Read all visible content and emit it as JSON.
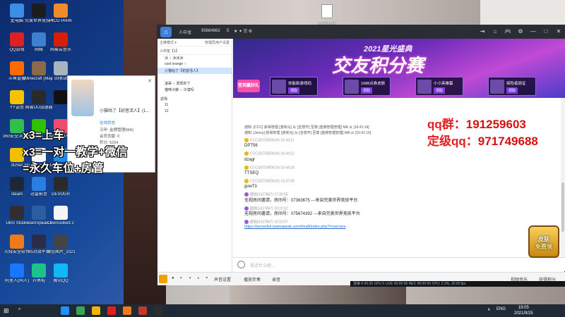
{
  "desktop_icons": [
    {
      "label": "此电脑",
      "color": "#3a8ee6"
    },
    {
      "label": "完美世界竞技平台",
      "color": "#1c1c1c"
    },
    {
      "label": "PICO PARK",
      "color": "#f08a2a"
    },
    {
      "label": "QQ游戏",
      "color": "#e02020"
    },
    {
      "label": "网络",
      "color": "#3f7fd0"
    },
    {
      "label": "网易云音乐",
      "color": "#d81e06"
    },
    {
      "label": "斗鱼直播",
      "color": "#ff6a00"
    },
    {
      "label": "Minecraft (Majiang...",
      "color": "#8a6a4a"
    },
    {
      "label": "回收站",
      "color": "#aab4bf"
    },
    {
      "label": "YY语音",
      "color": "#f7c300"
    },
    {
      "label": "网易UU加速器",
      "color": "#2a2a2a"
    },
    {
      "label": "",
      "color": "#111"
    },
    {
      "label": "360安全浏览器",
      "color": "#2fbf4a"
    },
    {
      "label": "微信",
      "color": "#2dc100"
    },
    {
      "label": "Pummel Party",
      "color": "#ef4d6d"
    },
    {
      "label": "3DSer",
      "color": "#f3c000"
    },
    {
      "label": "Human Fall Flat",
      "color": "#f5f5f5"
    },
    {
      "label": "Guest",
      "color": "#1e88e5"
    },
    {
      "label": "steam",
      "color": "#1b2838"
    },
    {
      "label": "迅雷影音",
      "color": "#2a7de1"
    },
    {
      "label": "DEVOUR",
      "color": "#2a2a2a"
    },
    {
      "label": "OBS Studio",
      "color": "#302e31"
    },
    {
      "label": "TeamSpeak 3",
      "color": "#2d5da1"
    },
    {
      "label": "Overcooked 2",
      "color": "#f5f5f5"
    },
    {
      "label": "火绒安全软件",
      "color": "#f07a1a"
    },
    {
      "label": "B5对战平台",
      "color": "#2b2b4a"
    },
    {
      "label": "微信图片_2021091...",
      "color": "#444"
    },
    {
      "label": "阿里人(同人)",
      "color": "#1677ff"
    },
    {
      "label": "开黑啦",
      "color": "#1ec28b"
    },
    {
      "label": "腾讯QQ",
      "color": "#12b7f5"
    }
  ],
  "file_icon": {
    "label": "config.cfg"
  },
  "profile_card": {
    "name": "小猫咕了【初音活人】(1...",
    "status": "在线状态",
    "rows": [
      {
        "k": "马甲:",
        "v": "金牌管理(MA)"
      },
      {
        "k": "会员贡献:",
        "v": "0"
      },
      {
        "k": "积分:",
        "v": "5234"
      }
    ],
    "close": "✕"
  },
  "overlay": {
    "line1": "x3=上车",
    "line2": "x3=一对一教学+微信",
    "line3": "=永久车位+房管"
  },
  "qq_info": {
    "label1": "qq群：",
    "num1": "191259603",
    "label2": "定级qq：",
    "num2": "971749688"
  },
  "titlebar": {
    "room_label": "人中龙",
    "room_id": "95684862",
    "user_count": "5",
    "buttons": [
      "⇥",
      "⌂",
      "🎮",
      "⚙",
      "—",
      "□",
      "✕"
    ]
  },
  "left_panel": {
    "tools_label": "主席模式 ▾",
    "tools_right": "管理员用户设置",
    "channel_header": "人中龙【1】",
    "items": [
      "冰 ♀ 冰冰冰",
      "cool orange ♀",
      "小猫咕了【初音活人】",
      "",
      "凌昊 ♀ 发现你了",
      "猫咪冷傲 ♀ 冷漠吗"
    ],
    "sub_header": "返场",
    "sub_items": [
      "11",
      "12"
    ]
  },
  "banner": {
    "year_label": "2021星光盛典",
    "title": "交友积分赛",
    "signin_label": "签到赢好礼",
    "cards": [
      {
        "tag": "小组主力",
        "title": "技能新游戏码",
        "btn": "领取"
      },
      {
        "tag": "上线奖励",
        "title": "1688点券皮肤",
        "btn": "领取"
      },
      {
        "tag": "日常活跃",
        "title": "小小英雄蛋",
        "btn": "领取"
      },
      {
        "tag": "DNF",
        "title": "探险者勋证",
        "btn": "领取"
      }
    ]
  },
  "chat": {
    "system": [
      "通知: [CCC] 获得管理 [游侠马] 从 [全感开] 至尊 [金牌管理管理] MA 从 [16:41:14]",
      "通知: [Jenny] 获得管理 [游侠马] 从 [全感开] 至尊 [金牌管理管理] MA 从 [16:41:16]"
    ],
    "messages": [
      {
        "author": "CCC(2670350619)",
        "time": "16:43:11",
        "body": "DPT56",
        "kind": "y"
      },
      {
        "author": "CCC(2670350619)",
        "time": "16:44:12",
        "body": "dzagr",
        "kind": "y"
      },
      {
        "author": "CCC(2670350619)",
        "time": "16:44:18",
        "body": "TTSEQ",
        "kind": "y"
      },
      {
        "author": "CCC(2670350619)",
        "time": "16:47:06",
        "body": "gvwT3",
        "kind": "y"
      },
      {
        "author": "面铭(3337867)",
        "time": "17:30:55",
        "body": "无视房间邀请，房间号：07363675 ---来自完美世界竞技平台",
        "kind": "p"
      },
      {
        "author": "面铭(3337867)",
        "time": "18:20:32",
        "body": "无视房间邀请，房间号：075674392 ---来自完美世界竞技平台",
        "kind": "p"
      },
      {
        "author": "面铭(3337867)",
        "time": "19:10:07",
        "body": "",
        "link": "https://serverlist.teamspeak.com/tmall/index.php?r=servers",
        "kind": "p"
      }
    ]
  },
  "input": {
    "placeholder": "说点什么吧..."
  },
  "toolbar": {
    "items": [
      "●",
      "◐",
      "◑",
      "◒",
      "◓",
      "声音设置",
      "播放伴奏",
      "录音"
    ],
    "right": [
      "视频音乐",
      "获得积分"
    ]
  },
  "statusbar": {
    "text": "连接  0  00:26  CPU  0  LIVE  00:00:00  REC  00:00:00  CPU: 2.2%, 30.00 fps"
  },
  "promo": {
    "line1": "皮肤",
    "line2": "免费领"
  },
  "taskbar": {
    "tray": [
      "∧",
      "ENG"
    ],
    "time": "19:05",
    "date": "2021/9/25",
    "icons": [
      "#1e90ff",
      "#3aa55a",
      "#f0b400",
      "#e02020",
      "#f07a1a",
      "#c0392b",
      "#2d2d2d",
      "#1b2838"
    ]
  },
  "colors": {
    "accent_red": "#e52020",
    "banner_purple": "#6b2bb8",
    "selection": "#cfe4ff"
  }
}
